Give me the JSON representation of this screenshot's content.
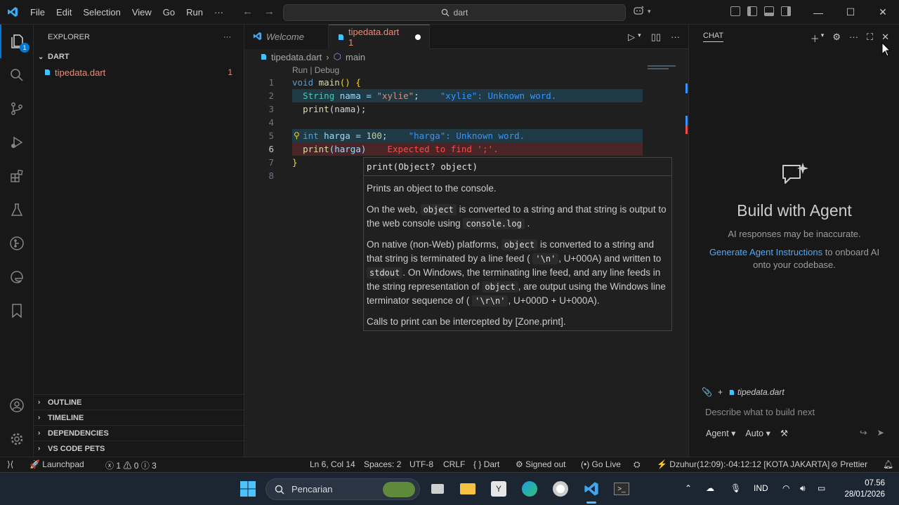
{
  "menu": [
    "File",
    "Edit",
    "Selection",
    "View",
    "Go",
    "Run"
  ],
  "search": {
    "text": "dart"
  },
  "sidebar": {
    "title": "EXPLORER",
    "folder": "DART",
    "file": {
      "name": "tipedata.dart",
      "problems": "1"
    },
    "sections": [
      "OUTLINE",
      "TIMELINE",
      "DEPENDENCIES",
      "VS CODE PETS"
    ]
  },
  "tabs": [
    {
      "label": "Welcome"
    },
    {
      "label": "tipedata.dart 1"
    }
  ],
  "breadcrumb": {
    "file": "tipedata.dart",
    "symbol": "main"
  },
  "codelens": "Run | Debug",
  "code": {
    "line_numbers": [
      "1",
      "2",
      "3",
      "4",
      "5",
      "6",
      "7",
      "8"
    ],
    "l1": {
      "a": "void",
      "b": " ",
      "c": "main",
      "d": "() {"
    },
    "l2": {
      "a": "String",
      "b": " nama = ",
      "c": "\"xylie\"",
      "d": ";",
      "inline": "\"xylie\": Unknown word."
    },
    "l3": {
      "a": "print",
      "b": "(nama);"
    },
    "l5": {
      "a": "int",
      "b": " harga = ",
      "c": "100",
      "d": ";",
      "inline": "\"harga\": Unknown word."
    },
    "l6": {
      "a": "print",
      "b": "(harga)",
      "inline": "Expected to find ';'."
    },
    "l7": {
      "a": "}"
    }
  },
  "hover": {
    "signature": "print(Object? object)",
    "p1": "Prints an object to the console.",
    "p2a": "On the web,",
    "p2code": "object",
    "p2b": "is converted to a string and that string is output to the web console using",
    "p2code2": "console.log",
    "p2c": ".",
    "p3a": "On native (non-Web) platforms,",
    "p3code": "object",
    "p3b": "is converted to a string and that string is terminated by a line feed (",
    "p3code2": "'\\n'",
    "p3c": ", U+000A) and written to",
    "p3code3": "stdout",
    "p3d": ". On Windows, the terminating line feed, and any line feeds in the string representation of",
    "p3code4": "object",
    "p3e": ", are output using the Windows line terminator sequence of (",
    "p3code5": "'\\r\\n'",
    "p3f": ", U+000D + U+000A).",
    "p4": "Calls to print can be intercepted by [Zone.print]."
  },
  "chat": {
    "title": "CHAT",
    "heading": "Build with Agent",
    "sub": "AI responses may be inaccurate.",
    "link": "Generate Agent Instructions",
    "desc": "to onboard AI onto your codebase.",
    "context_file": "tipedata.dart",
    "placeholder": "Describe what to build next",
    "mode": "Agent",
    "model": "Auto"
  },
  "statusbar": {
    "launchpad": "Launchpad",
    "errors": "1",
    "warnings": "0",
    "infos": "3",
    "position": "Ln 6, Col 14",
    "spaces": "Spaces: 2",
    "encoding": "UTF-8",
    "eol": "CRLF",
    "language": "Dart",
    "signed": "Signed out",
    "live": "Go Live",
    "prayer": "Dzuhur(12:09):-04:12:12 [KOTA JAKARTA]",
    "prettier": "Prettier"
  },
  "taskbar": {
    "search": "Pencarian",
    "lang": "IND",
    "time": "07.56",
    "date": "28/01/2026"
  },
  "colors": {
    "accent": "#0078d4",
    "error": "#f48771",
    "link": "#4daafc"
  }
}
